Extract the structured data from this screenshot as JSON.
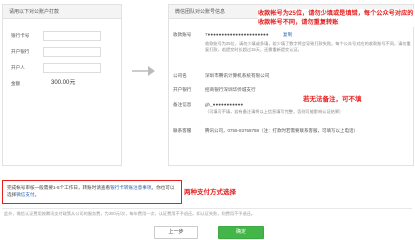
{
  "left_panel": {
    "title": "请用以下对公账户打款",
    "fields": [
      {
        "label": "银行卡号",
        "value": ""
      },
      {
        "label": "开户银行",
        "value": ""
      },
      {
        "label": "开户人",
        "value": ""
      },
      {
        "label": "金额",
        "value": "300.00元"
      }
    ]
  },
  "right_panel": {
    "title": "微信团队对公账号信息",
    "account_label": "收款账号",
    "account_number": "7●●●●●●●●●●●●●●●●●●●●●●",
    "copy_link": "复制",
    "hint1": "收款账号为25位，请勿少填或多填，若少填了数字将会导致打款失败。每个公众号对应的收款账号不同，请勿重复打款，若提交时长超过15天，还需重新提交认证。",
    "company_label": "公司名",
    "company_value": "深圳市腾讯计算机系统有限公司",
    "bank_label": "开户银行",
    "bank_value": "招商银行深圳华侨城支行",
    "note_label": "备注信息",
    "note_value": "gh_●●●●●●●●●●●",
    "note_hint": "（可填可不填，若有备注请将以上信息填写完整，否则可能影响认证结果）",
    "contact_label": "联系客服",
    "contact_value": "腾讯公司，0755-83768788（注：打款时若需要联系客服，可填写以上电话）"
  },
  "notice": {
    "text1": "完成帐号审核一般需要1-5个工作日，转账时请查看",
    "link1": "银行卡转账注意事项",
    "text2": "。你也可以选择",
    "link2": "微信支付",
    "text3": "。"
  },
  "annotations": {
    "top": "收款帐号为25位，请勿少填或是填错，每个公众号对应的收款帐号不同，请勿重复转账",
    "middle": "若无法备注，可不填",
    "bottom": "两种支付方式选择"
  },
  "footer_text": "此外，微信认证费用按腾讯支付政策从公司的服务费，为300元/次，每年费用一次，认证费用不予退还。如认证失败，则费用不予退还。",
  "buttons": {
    "prev": "上一步",
    "confirm": "确定"
  },
  "colors": {
    "accent_green": "#44b549",
    "annotation_red": "#e61f1f",
    "link_blue": "#2d64b3"
  }
}
